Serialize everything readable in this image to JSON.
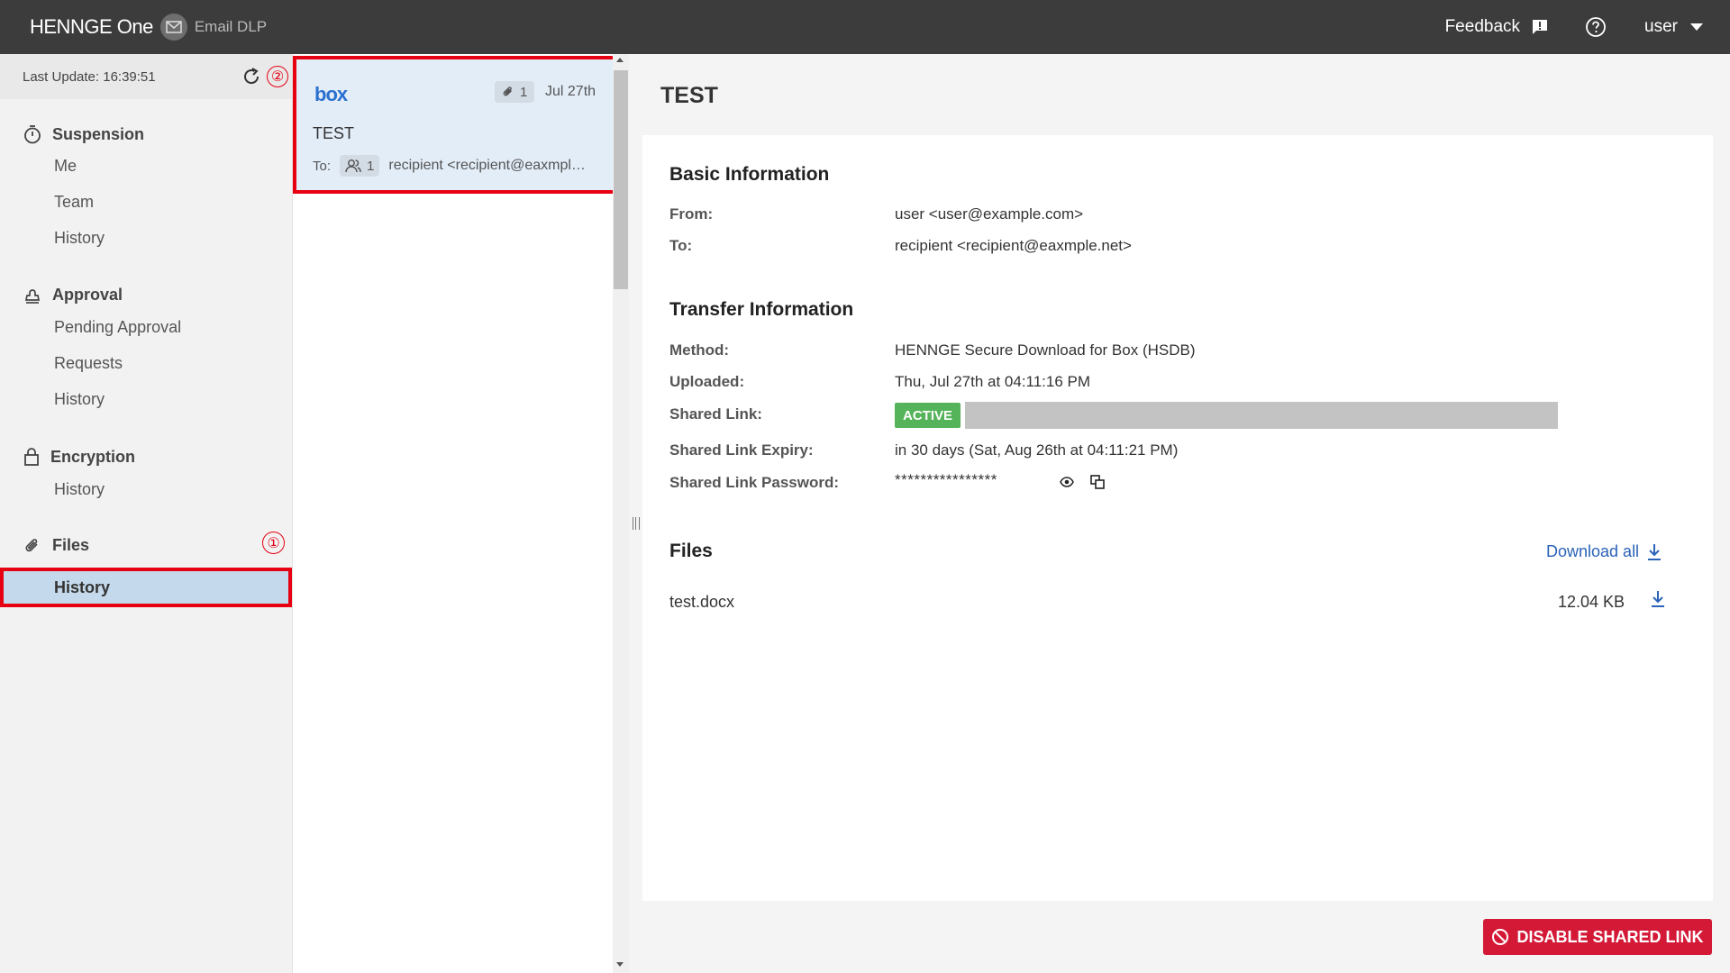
{
  "header": {
    "brand": "HENNGE One",
    "product": "Email DLP",
    "feedback_label": "Feedback",
    "user_label": "user"
  },
  "sidebar": {
    "last_update": "Last Update: 16:39:51",
    "badge_refresh": "②",
    "badge_files": "①",
    "sections": [
      {
        "title": "Suspension",
        "items": [
          "Me",
          "Team",
          "History"
        ]
      },
      {
        "title": "Approval",
        "items": [
          "Pending Approval",
          "Requests",
          "History"
        ]
      },
      {
        "title": "Encryption",
        "items": [
          "History"
        ]
      },
      {
        "title": "Files",
        "items": [
          "History"
        ]
      }
    ]
  },
  "list": {
    "card": {
      "provider": "box",
      "attachments": "1",
      "date": "Jul 27th",
      "subject": "TEST",
      "to_label": "To:",
      "recipient_count": "1",
      "recipient": "recipient <recipient@eaxmple.net>"
    }
  },
  "detail": {
    "title": "TEST",
    "basic_heading": "Basic Information",
    "from_label": "From:",
    "from_value": "user <user@example.com>",
    "to_label": "To:",
    "to_value": "recipient <recipient@eaxmple.net>",
    "transfer_heading": "Transfer Information",
    "method_label": "Method:",
    "method_value": "HENNGE Secure Download for Box (HSDB)",
    "uploaded_label": "Uploaded:",
    "uploaded_value": "Thu, Jul 27th at 04:11:16 PM",
    "shared_link_label": "Shared Link:",
    "shared_link_status": "ACTIVE",
    "expiry_label": "Shared Link Expiry:",
    "expiry_value": "in 30 days (Sat, Aug 26th at 04:11:21 PM)",
    "password_label": "Shared Link Password:",
    "password_value": "****************",
    "files_heading": "Files",
    "download_all_label": "Download all",
    "files": [
      {
        "name": "test.docx",
        "size": "12.04 KB"
      }
    ],
    "disable_button_label": "DISABLE SHARED LINK"
  },
  "colors": {
    "topbar": "#3c3c3c",
    "highlight": "#e60012",
    "active_green": "#55b35a",
    "link_blue": "#2a63b8",
    "danger": "#d41937"
  }
}
